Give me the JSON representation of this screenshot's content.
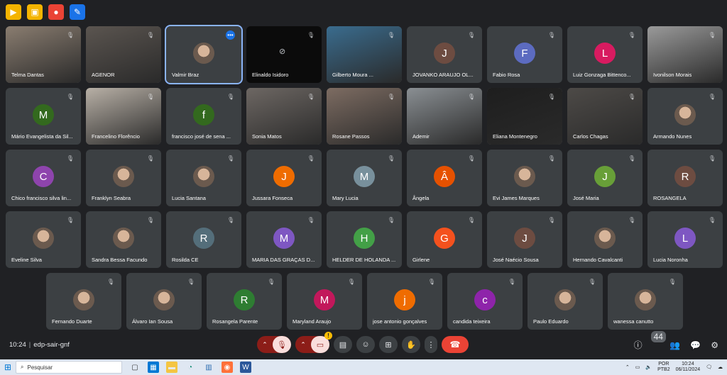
{
  "extensions": [
    {
      "name": "ext-icon-1",
      "color": "#f4b400",
      "glyph": "▶"
    },
    {
      "name": "ext-icon-2",
      "color": "#f4b400",
      "glyph": "▣"
    },
    {
      "name": "ext-icon-3",
      "color": "#ea4335",
      "glyph": "●"
    },
    {
      "name": "ext-icon-4",
      "color": "#1a73e8",
      "glyph": "✎"
    }
  ],
  "participants": [
    {
      "name": "Telma Dantas",
      "kind": "video",
      "bg": "#8a7d70"
    },
    {
      "name": "AGENOR",
      "kind": "video",
      "bg": "#5b5550"
    },
    {
      "name": "Valmir Braz",
      "kind": "photo",
      "speaking": true
    },
    {
      "name": "Elinaldo Isidoro",
      "kind": "camoff"
    },
    {
      "name": "Gilberto Moura ...",
      "kind": "video",
      "bg": "#3a6c8e"
    },
    {
      "name": "JOVANKO ARAUJO OL...",
      "kind": "letter",
      "letter": "J",
      "color": "#6d4c41"
    },
    {
      "name": "Fabio Rosa",
      "kind": "letter",
      "letter": "F",
      "color": "#5c6bc0"
    },
    {
      "name": "Luiz Gonzaga Bittenco...",
      "kind": "letter",
      "letter": "L",
      "color": "#d81b60"
    },
    {
      "name": "Ivonilson Morais",
      "kind": "video",
      "bg": "#9a9a9a"
    },
    {
      "name": "Mário Evangelista da Sil...",
      "kind": "letter",
      "letter": "M",
      "color": "#33691e"
    },
    {
      "name": "Francelino Florêncio",
      "kind": "video",
      "bg": "#b8b0a6"
    },
    {
      "name": "francisco josé de sena ...",
      "kind": "letter",
      "letter": "f",
      "color": "#33691e"
    },
    {
      "name": "Sonia Matos",
      "kind": "video",
      "bg": "#6d6763"
    },
    {
      "name": "Rosane Passos",
      "kind": "video",
      "bg": "#7d6c62"
    },
    {
      "name": "Ademir",
      "kind": "video",
      "bg": "#8a8f93"
    },
    {
      "name": "Eliana Montenegro",
      "kind": "video",
      "bg": "#1e1e1e"
    },
    {
      "name": "Carlos Chagas",
      "kind": "video",
      "bg": "#4d4a47"
    },
    {
      "name": "Armando Nunes",
      "kind": "photo"
    },
    {
      "name": "Chico francisco silva lin...",
      "kind": "letter",
      "letter": "C",
      "color": "#8e44ad"
    },
    {
      "name": "Franklyn Seabra",
      "kind": "photo"
    },
    {
      "name": "Lucia Santana",
      "kind": "photo"
    },
    {
      "name": "Jussara Fonseca",
      "kind": "letter",
      "letter": "J",
      "color": "#ef6c00"
    },
    {
      "name": "Mary Lucia",
      "kind": "letter",
      "letter": "M",
      "color": "#78909c"
    },
    {
      "name": "Ângela",
      "kind": "letter",
      "letter": "Â",
      "color": "#e65100"
    },
    {
      "name": "Evi James Marques",
      "kind": "photo"
    },
    {
      "name": "José Maria",
      "kind": "letter",
      "letter": "J",
      "color": "#689f38"
    },
    {
      "name": "ROSANGELA",
      "kind": "letter",
      "letter": "R",
      "color": "#6d4c41"
    },
    {
      "name": "Eveline Silva",
      "kind": "photo"
    },
    {
      "name": "Sandra Bessa Facundo",
      "kind": "photo"
    },
    {
      "name": "Rosilda CE",
      "kind": "letter",
      "letter": "R",
      "color": "#546e7a"
    },
    {
      "name": "MARIA DAS GRAÇAS D...",
      "kind": "letter",
      "letter": "M",
      "color": "#7e57c2"
    },
    {
      "name": "HELDER DE HOLANDA ...",
      "kind": "letter",
      "letter": "H",
      "color": "#43a047"
    },
    {
      "name": "Girlene",
      "kind": "letter",
      "letter": "G",
      "color": "#f4511e"
    },
    {
      "name": "José Naécio Sousa",
      "kind": "letter",
      "letter": "J",
      "color": "#6d4c41"
    },
    {
      "name": "Hernando Cavalcanti",
      "kind": "photo"
    },
    {
      "name": "Lucia Noronha",
      "kind": "letter",
      "letter": "L",
      "color": "#7e57c2"
    },
    {
      "name": "Fernando Duarte",
      "kind": "photo"
    },
    {
      "name": "Álvaro Ian Sousa",
      "kind": "photo"
    },
    {
      "name": "Rosangela Parente",
      "kind": "letter",
      "letter": "R",
      "color": "#2e7d32"
    },
    {
      "name": "Maryland Araujo",
      "kind": "letter",
      "letter": "M",
      "color": "#c2185b"
    },
    {
      "name": "jose antonio gonçalves",
      "kind": "letter",
      "letter": "j",
      "color": "#ef6c00"
    },
    {
      "name": "candida teixeira",
      "kind": "letter",
      "letter": "c",
      "color": "#8e24aa"
    },
    {
      "name": "Paulo Eduardo",
      "kind": "photo"
    },
    {
      "name": "wanessa canutto",
      "kind": "photo"
    }
  ],
  "meeting": {
    "time": "10:24",
    "code": "edp-sair-gnf"
  },
  "controls": {
    "people_count": "44"
  },
  "taskbar": {
    "search_placeholder": "Pesquisar",
    "lang1": "POR",
    "lang2": "PTB2",
    "clock_time": "10:24",
    "clock_date": "06/11/2024"
  }
}
